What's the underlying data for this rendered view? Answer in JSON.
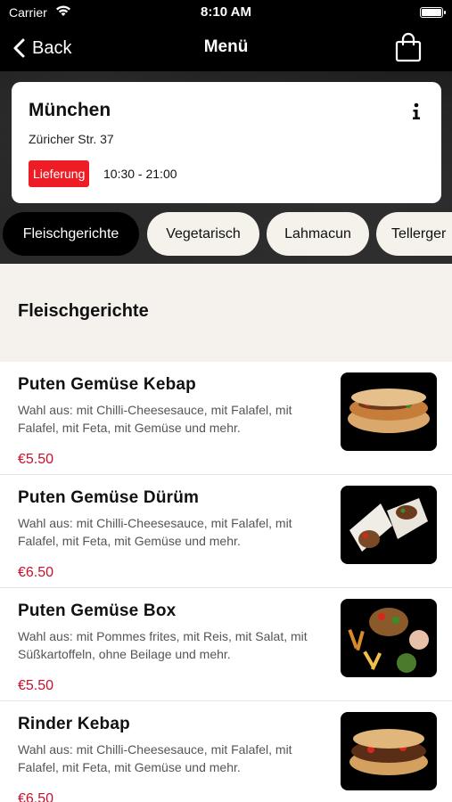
{
  "status_bar": {
    "carrier": "Carrier",
    "time": "8:10 AM"
  },
  "nav": {
    "back_label": "Back",
    "title": "Menü"
  },
  "store": {
    "name": "München",
    "address": "Züricher Str. 37",
    "delivery_badge": "Lieferung",
    "hours": "10:30 - 21:00"
  },
  "tabs": [
    {
      "label": "Fleischgerichte",
      "active": true
    },
    {
      "label": "Vegetarisch",
      "active": false
    },
    {
      "label": "Lahmacun",
      "active": false
    },
    {
      "label": "Tellerger",
      "active": false
    }
  ],
  "section": {
    "title": "Fleischgerichte"
  },
  "items": [
    {
      "name": "Puten Gemüse Kebap",
      "description": "Wahl aus: mit Chilli-Cheesesauce, mit Falafel, mit Falafel, mit Feta, mit Gemüse und mehr.",
      "price": "€5.50",
      "image_icon": "kebap-sandwich-image"
    },
    {
      "name": "Puten Gemüse Dürüm",
      "description": "Wahl aus: mit Chilli-Cheesesauce, mit Falafel, mit Falafel, mit Feta, mit Gemüse und mehr.",
      "price": "€6.50",
      "image_icon": "durum-wrap-image"
    },
    {
      "name": "Puten Gemüse Box",
      "description": "Wahl aus: mit Pommes frites, mit Reis, mit Salat, mit Süßkartoffeln, ohne Beilage und mehr.",
      "price": "€5.50",
      "image_icon": "kebap-box-image"
    },
    {
      "name": "Rinder Kebap",
      "description": "Wahl aus: mit Chilli-Cheesesauce, mit Falafel, mit Falafel, mit Feta, mit Gemüse und mehr.",
      "price": "€6.50",
      "image_icon": "kebap-sandwich-image"
    }
  ],
  "colors": {
    "accent_red": "#ee1c24",
    "price_red": "#c8102e",
    "tab_active_bg": "#000000",
    "tab_inactive_bg": "#f5f2ec"
  }
}
